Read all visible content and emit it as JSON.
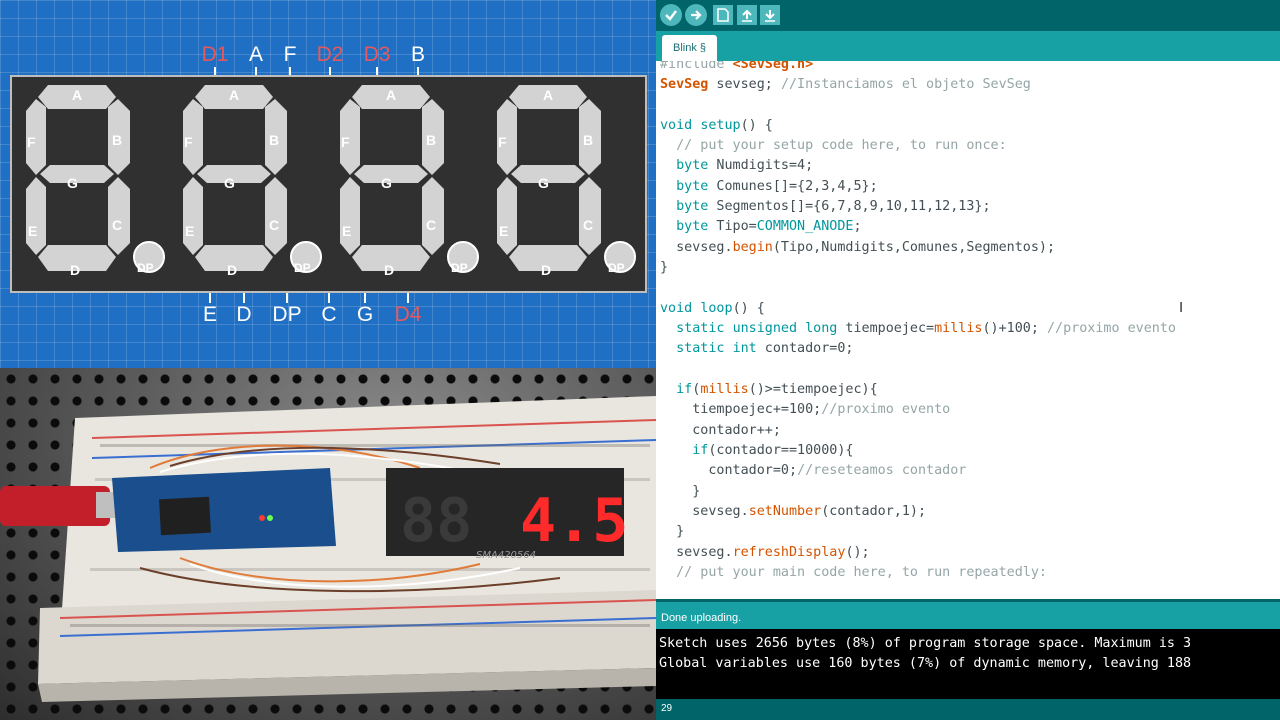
{
  "diagram": {
    "top_pins": [
      {
        "label": "D1",
        "color": "#e8585a"
      },
      {
        "label": "A",
        "color": "#ffffff"
      },
      {
        "label": "F",
        "color": "#ffffff"
      },
      {
        "label": "D2",
        "color": "#e8585a"
      },
      {
        "label": "D3",
        "color": "#e8585a"
      },
      {
        "label": "B",
        "color": "#ffffff"
      }
    ],
    "bottom_pins": [
      {
        "label": "E",
        "color": "#ffffff"
      },
      {
        "label": "D",
        "color": "#ffffff"
      },
      {
        "label": "DP",
        "color": "#ffffff"
      },
      {
        "label": "C",
        "color": "#ffffff"
      },
      {
        "label": "G",
        "color": "#ffffff"
      },
      {
        "label": "D4",
        "color": "#e8585a"
      }
    ],
    "segment_labels": {
      "a": "A",
      "b": "B",
      "c": "C",
      "d": "D",
      "e": "E",
      "f": "F",
      "g": "G",
      "dp": "DP"
    },
    "digit_count": 4
  },
  "photo": {
    "display_part_number": "SMA420564",
    "display_reading": "4.5"
  },
  "ide": {
    "tab_label": "Blink §",
    "toolbar_icons": [
      "verify-icon",
      "upload-icon",
      "new-icon",
      "open-icon",
      "save-icon"
    ],
    "code_lines": [
      "#include <SevSeg.h>",
      "SevSeg sevseg; //Instanciamos el objeto SevSeg",
      "",
      "void setup() {",
      "  // put your setup code here, to run once:",
      "  byte Numdigits=4;",
      "  byte Comunes[]={2,3,4,5};",
      "  byte Segmentos[]={6,7,8,9,10,11,12,13};",
      "  byte Tipo=COMMON_ANODE;",
      "  sevseg.begin(Tipo,Numdigits,Comunes,Segmentos);",
      "}",
      "",
      "void loop() {",
      "  static unsigned long tiempoejec=millis()+100; //proximo evento",
      "  static int contador=0;",
      "",
      "  if(millis()>=tiempoejec){",
      "    tiempoejec+=100;//proximo evento",
      "    contador++;",
      "    if(contador==10000){",
      "      contador=0;//reseteamos contador",
      "    }",
      "    sevseg.setNumber(contador,1);",
      "  }",
      "  sevseg.refreshDisplay();",
      "  // put your main code here, to run repeatedly:"
    ],
    "status": "Done uploading.",
    "console_lines": [
      "Sketch uses 2656 bytes (8%) of program storage space. Maximum is 3",
      "Global variables use 160 bytes (7%) of dynamic memory, leaving 188"
    ],
    "line_number": "29",
    "colors": {
      "toolbar": "#006468",
      "tabs": "#17a1a5",
      "keyword": "#00979c",
      "function": "#d35400",
      "comment": "#95a5a6"
    }
  }
}
